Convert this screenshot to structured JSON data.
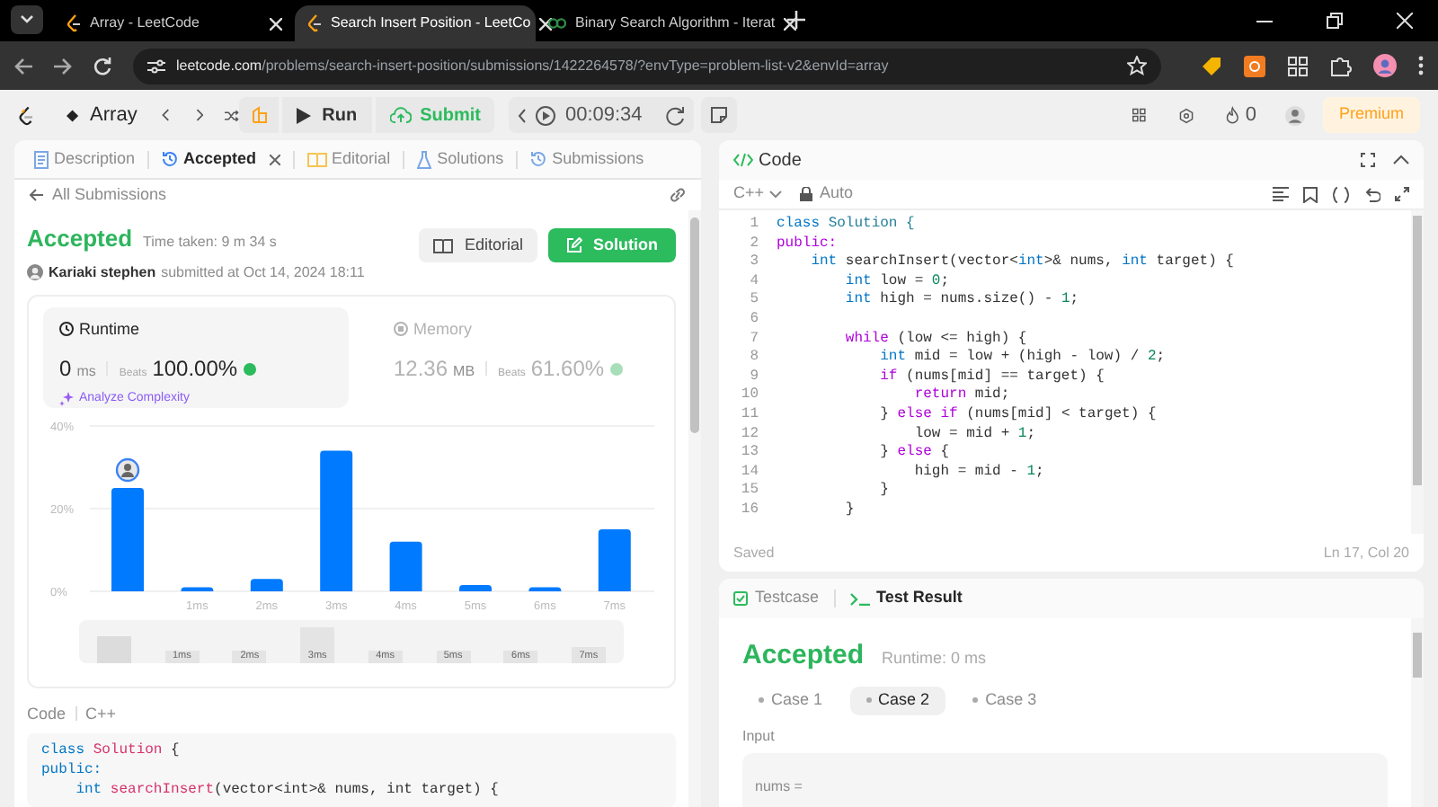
{
  "browser": {
    "tabs": [
      {
        "title": "Array - LeetCode",
        "selected": false,
        "kind": "leetcode"
      },
      {
        "title": "Search Insert Position - LeetCo",
        "selected": true,
        "kind": "leetcode"
      },
      {
        "title": "Binary Search Algorithm - Iterat",
        "selected": false,
        "kind": "gfg"
      }
    ],
    "url_host": "leetcode.com",
    "url_path": "/problems/search-insert-position/submissions/1422264578/?envType=problem-list-v2&envId=array"
  },
  "nav": {
    "problem_list": "Array",
    "run": "Run",
    "submit": "Submit",
    "timer": "00:09:34",
    "streak": "0",
    "premium": "Premium"
  },
  "left_tabs": [
    {
      "label": "Description",
      "selected": false,
      "closable": false,
      "kind": "description"
    },
    {
      "label": "Accepted",
      "selected": true,
      "closable": true,
      "kind": "accepted"
    },
    {
      "label": "Editorial",
      "selected": false,
      "closable": false,
      "kind": "editorial"
    },
    {
      "label": "Solutions",
      "selected": false,
      "closable": false,
      "kind": "solutions"
    },
    {
      "label": "Submissions",
      "selected": false,
      "closable": false,
      "kind": "submissions"
    }
  ],
  "back_link": "All Submissions",
  "submission": {
    "status": "Accepted",
    "time_taken": "Time taken: 9 m 34 s",
    "author": "Kariaki stephen",
    "submitted": "submitted at Oct 14, 2024 18:11",
    "editorial_button": "Editorial",
    "solution_button": "Solution"
  },
  "metrics": [
    {
      "title": "Runtime",
      "value": "0",
      "unit": "ms",
      "beats_label": "Beats",
      "beats": "100.00%",
      "selected": true,
      "kind": "runtime"
    },
    {
      "title": "Memory",
      "value": "12.36",
      "unit": "MB",
      "beats_label": "Beats",
      "beats": "61.60%",
      "selected": false,
      "kind": "memory"
    }
  ],
  "analyze": "Analyze Complexity",
  "distribution": {
    "chart_data": {
      "type": "bar",
      "categories": [
        null,
        "1ms",
        "2ms",
        "3ms",
        "4ms",
        "5ms",
        "6ms",
        "7ms"
      ],
      "series": [
        {
          "color": "#007aff",
          "values": [
            25,
            1,
            3,
            34,
            12,
            1.5,
            1,
            15
          ]
        }
      ],
      "ylim": [
        0,
        40
      ],
      "yticks": [
        {
          "value": 0,
          "label": "0%"
        },
        {
          "value": 20,
          "label": "20%"
        },
        {
          "value": 40,
          "label": "40%"
        }
      ]
    },
    "range_labels": [
      "1ms",
      "2ms",
      "3ms",
      "4ms",
      "5ms",
      "6ms",
      "7ms"
    ]
  },
  "code_view": {
    "label": "Code",
    "language": "C++",
    "lines": [
      [
        {
          "text": "class",
          "kind": "kw"
        },
        {
          "text": " Solution",
          "kind": "cls"
        },
        {
          "text": " {",
          "kind": "plain"
        }
      ],
      [
        {
          "text": "public:",
          "kind": "kw"
        }
      ],
      [
        {
          "text": "    int",
          "kind": "kw"
        },
        {
          "text": " searchInsert",
          "kind": "cls"
        },
        {
          "text": "(vector<int>& nums, int target) {",
          "kind": "plain"
        }
      ]
    ]
  },
  "editor": {
    "title": "Code",
    "language": "C++",
    "mode": "Auto",
    "lines": [
      {
        "n": "1",
        "tokens": [
          {
            "text": "class",
            "kind": "kw"
          },
          {
            "text": " Solution {",
            "kind": "type"
          }
        ]
      },
      {
        "n": "2",
        "tokens": [
          {
            "text": "public:",
            "kind": "ctrl"
          }
        ]
      },
      {
        "n": "3",
        "tokens": [
          {
            "text": "    int",
            "kind": "kw"
          },
          {
            "text": " searchInsert(vector<",
            "kind": "plain"
          },
          {
            "text": "int",
            "kind": "kw"
          },
          {
            "text": ">& nums, ",
            "kind": "plain"
          },
          {
            "text": "int",
            "kind": "kw"
          },
          {
            "text": " target) {",
            "kind": "plain"
          }
        ]
      },
      {
        "n": "4",
        "tokens": [
          {
            "text": "        int",
            "kind": "kw"
          },
          {
            "text": " low = ",
            "kind": "plain"
          },
          {
            "text": "0",
            "kind": "num"
          },
          {
            "text": ";",
            "kind": "plain"
          }
        ]
      },
      {
        "n": "5",
        "tokens": [
          {
            "text": "        int",
            "kind": "kw"
          },
          {
            "text": " high = nums.size() - ",
            "kind": "plain"
          },
          {
            "text": "1",
            "kind": "num"
          },
          {
            "text": ";",
            "kind": "plain"
          }
        ]
      },
      {
        "n": "6"
      },
      {
        "n": "7",
        "tokens": [
          {
            "text": "        while",
            "kind": "ctrl"
          },
          {
            "text": " (low <= high) {",
            "kind": "plain"
          }
        ]
      },
      {
        "n": "8",
        "tokens": [
          {
            "text": "            int",
            "kind": "kw"
          },
          {
            "text": " mid = low + (high - low) / ",
            "kind": "plain"
          },
          {
            "text": "2",
            "kind": "num"
          },
          {
            "text": ";",
            "kind": "plain"
          }
        ]
      },
      {
        "n": "9",
        "tokens": [
          {
            "text": "            if",
            "kind": "ctrl"
          },
          {
            "text": " (nums[mid] == target) {",
            "kind": "plain"
          }
        ]
      },
      {
        "n": "10",
        "tokens": [
          {
            "text": "                return",
            "kind": "ctrl"
          },
          {
            "text": " mid;",
            "kind": "plain"
          }
        ]
      },
      {
        "n": "11",
        "tokens": [
          {
            "text": "            } ",
            "kind": "plain"
          },
          {
            "text": "else if",
            "kind": "ctrl"
          },
          {
            "text": " (nums[mid] < target) {",
            "kind": "plain"
          }
        ]
      },
      {
        "n": "12",
        "tokens": [
          {
            "text": "                low = mid + ",
            "kind": "plain"
          },
          {
            "text": "1",
            "kind": "num"
          },
          {
            "text": ";",
            "kind": "plain"
          }
        ]
      },
      {
        "n": "13",
        "tokens": [
          {
            "text": "            } ",
            "kind": "plain"
          },
          {
            "text": "else",
            "kind": "ctrl"
          },
          {
            "text": " {",
            "kind": "plain"
          }
        ]
      },
      {
        "n": "14",
        "tokens": [
          {
            "text": "                high = mid - ",
            "kind": "plain"
          },
          {
            "text": "1",
            "kind": "num"
          },
          {
            "text": ";",
            "kind": "plain"
          }
        ]
      },
      {
        "n": "15",
        "tokens": [
          {
            "text": "            }",
            "kind": "plain"
          }
        ]
      },
      {
        "n": "16",
        "tokens": [
          {
            "text": "        }",
            "kind": "plain"
          }
        ]
      }
    ],
    "status": "Saved",
    "cursor": "Ln 17, Col 20"
  },
  "test": {
    "tabs": [
      {
        "label": "Testcase",
        "selected": false,
        "kind": "testcase"
      },
      {
        "label": "Test Result",
        "selected": true,
        "kind": "result"
      }
    ],
    "status": "Accepted",
    "runtime": "Runtime: 0 ms",
    "cases": [
      {
        "label": "Case 1",
        "selected": false
      },
      {
        "label": "Case 2",
        "selected": true
      },
      {
        "label": "Case 3",
        "selected": false
      }
    ],
    "input_label": "Input",
    "input_var": "nums ="
  }
}
